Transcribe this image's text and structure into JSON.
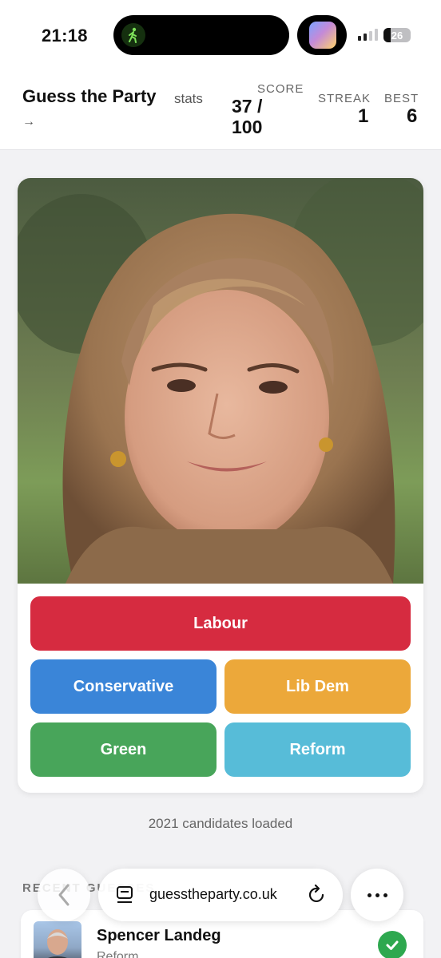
{
  "status_bar": {
    "time": "21:18",
    "battery": "26"
  },
  "header": {
    "title": "Guess the Party",
    "stats_link": "stats",
    "stats_arrow": "→",
    "score_label": "SCORE",
    "score_value": "37 / 100",
    "streak_label": "STREAK",
    "streak_value": "1",
    "best_label": "BEST",
    "best_value": "6"
  },
  "candidate_photo": {
    "icon": "portrait-photo"
  },
  "parties": [
    {
      "label": "Labour",
      "color": "#d62b40"
    },
    {
      "label": "Conservative",
      "color": "#3a85d8"
    },
    {
      "label": "Lib Dem",
      "color": "#eca83a"
    },
    {
      "label": "Green",
      "color": "#48a55a"
    },
    {
      "label": "Reform",
      "color": "#57bcd8"
    }
  ],
  "loaded_text": "2021 candidates loaded",
  "recent": {
    "heading": "RECENT GUESSES",
    "items": [
      {
        "name": "Spencer Landeg",
        "party": "Reform",
        "result_icon": "check-icon"
      }
    ]
  },
  "browser": {
    "url": "guesstheparty.co.uk"
  }
}
